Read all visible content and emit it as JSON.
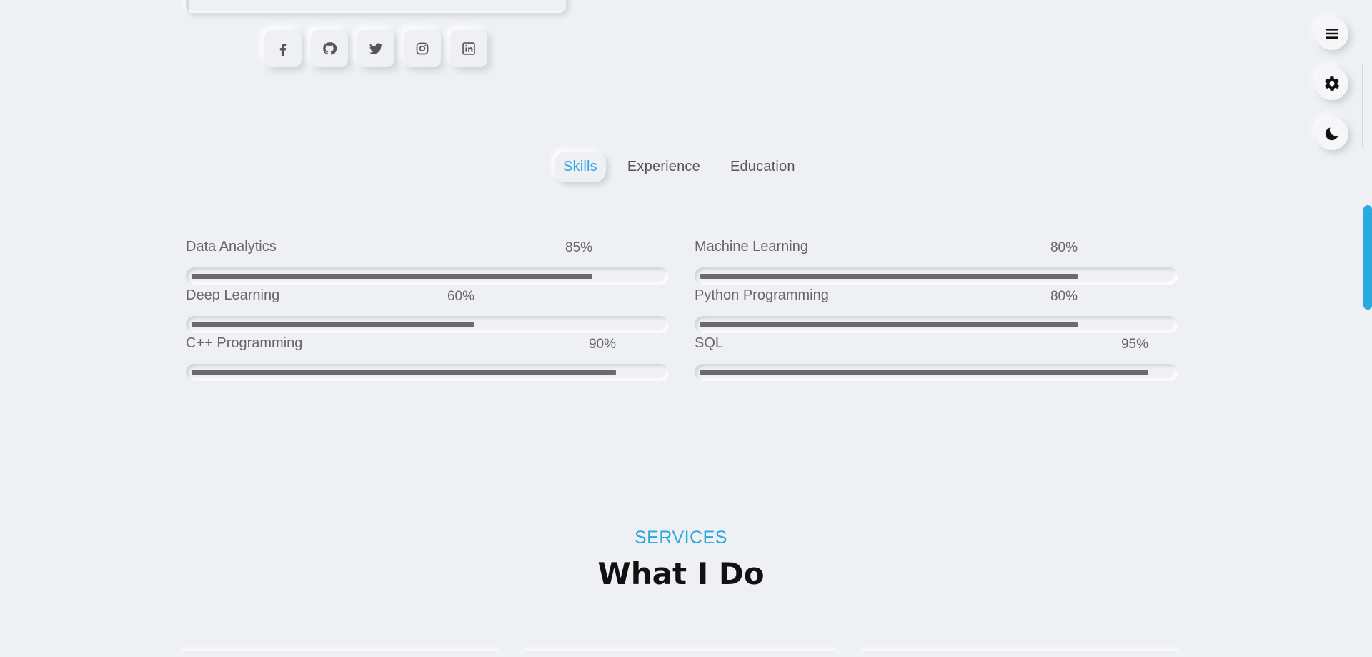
{
  "colors": {
    "accent": "#2aa8e0",
    "background": "#eef0f4",
    "bar_fill": "#6b6b6b",
    "heading": "#111111"
  },
  "socials": [
    {
      "name": "facebook-icon",
      "label": "f"
    },
    {
      "name": "github-icon"
    },
    {
      "name": "twitter-icon"
    },
    {
      "name": "instagram-icon"
    },
    {
      "name": "linkedin-icon"
    }
  ],
  "controls": {
    "menu_icon": "menu-icon",
    "settings_icon": "gear-icon",
    "theme_icon": "moon-icon"
  },
  "tabs": [
    {
      "label": "Skills",
      "active": true
    },
    {
      "label": "Experience",
      "active": false
    },
    {
      "label": "Education",
      "active": false
    }
  ],
  "skills": [
    {
      "name": "Data Analytics",
      "percent_label": "85%",
      "value": 0.85
    },
    {
      "name": "Machine Learning",
      "percent_label": "80%",
      "value": 0.8
    },
    {
      "name": "Deep Learning",
      "percent_label": "60%",
      "value": 0.6
    },
    {
      "name": "Python Programming",
      "percent_label": "80%",
      "value": 0.8
    },
    {
      "name": "C++ Programming",
      "percent_label": "90%",
      "value": 0.9
    },
    {
      "name": "SQL",
      "percent_label": "95%",
      "value": 0.95
    }
  ],
  "services": {
    "kicker": "SERVICES",
    "title": "What I Do"
  }
}
